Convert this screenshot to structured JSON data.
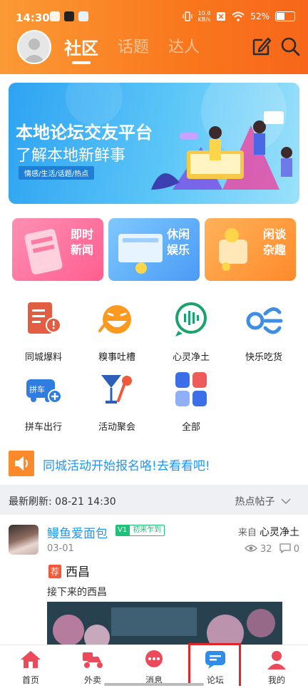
{
  "status_bar": {
    "time": "14:30",
    "net_speed_value": "10.8",
    "net_speed_unit": "KB/s",
    "battery": "52%",
    "battery_level": 0.52
  },
  "header": {
    "tabs": [
      {
        "label": "社区",
        "active": true
      },
      {
        "label": "话题",
        "active": false
      },
      {
        "label": "达人",
        "active": false
      }
    ],
    "icons": [
      "edit-icon",
      "search-icon"
    ],
    "accent_color": "#f9771d"
  },
  "banner": {
    "title": "本地论坛交友平台",
    "subtitle": "了解本地新鲜事",
    "tags": "情感/生活/话题/热点"
  },
  "features": [
    {
      "label_line1": "即时",
      "label_line2": "新闻"
    },
    {
      "label_line1": "休闲",
      "label_line2": "娱乐"
    },
    {
      "label_line1": "闲谈",
      "label_line2": "杂趣"
    }
  ],
  "categories": [
    {
      "label": "同城爆料",
      "icon": "report-icon"
    },
    {
      "label": "糗事吐槽",
      "icon": "laugh-icon"
    },
    {
      "label": "心灵净土",
      "icon": "chat-wave-icon"
    },
    {
      "label": "快乐吃货",
      "icon": "food-icon"
    },
    {
      "label": "拼车出行",
      "icon": "carpool-icon"
    },
    {
      "label": "活动聚会",
      "icon": "party-icon"
    },
    {
      "label": "全部",
      "icon": "all-grid-icon"
    }
  ],
  "carpool_badge": "拼车",
  "notice": {
    "text": "同城活动开始报名咯!去看看吧!"
  },
  "feed_header": {
    "refresh_label": "最新刷新:",
    "refresh_time": "08-21 14:30",
    "sort_label": "热点帖子"
  },
  "post": {
    "username": "鳗鱼爱面包",
    "level": "V1",
    "level_name": "初来乍到",
    "from_prefix": "来自",
    "from_board": "心灵净土",
    "date": "03-01",
    "views": "32",
    "comments": "0",
    "recommend_badge": "荐",
    "title": "西昌",
    "body": "接下来的西昌"
  },
  "bottom_nav": [
    {
      "label": "首页",
      "icon": "home-icon"
    },
    {
      "label": "外卖",
      "icon": "delivery-icon"
    },
    {
      "label": "消息",
      "icon": "message-icon"
    },
    {
      "label": "论坛",
      "icon": "forum-icon"
    },
    {
      "label": "我的",
      "icon": "profile-icon"
    }
  ]
}
